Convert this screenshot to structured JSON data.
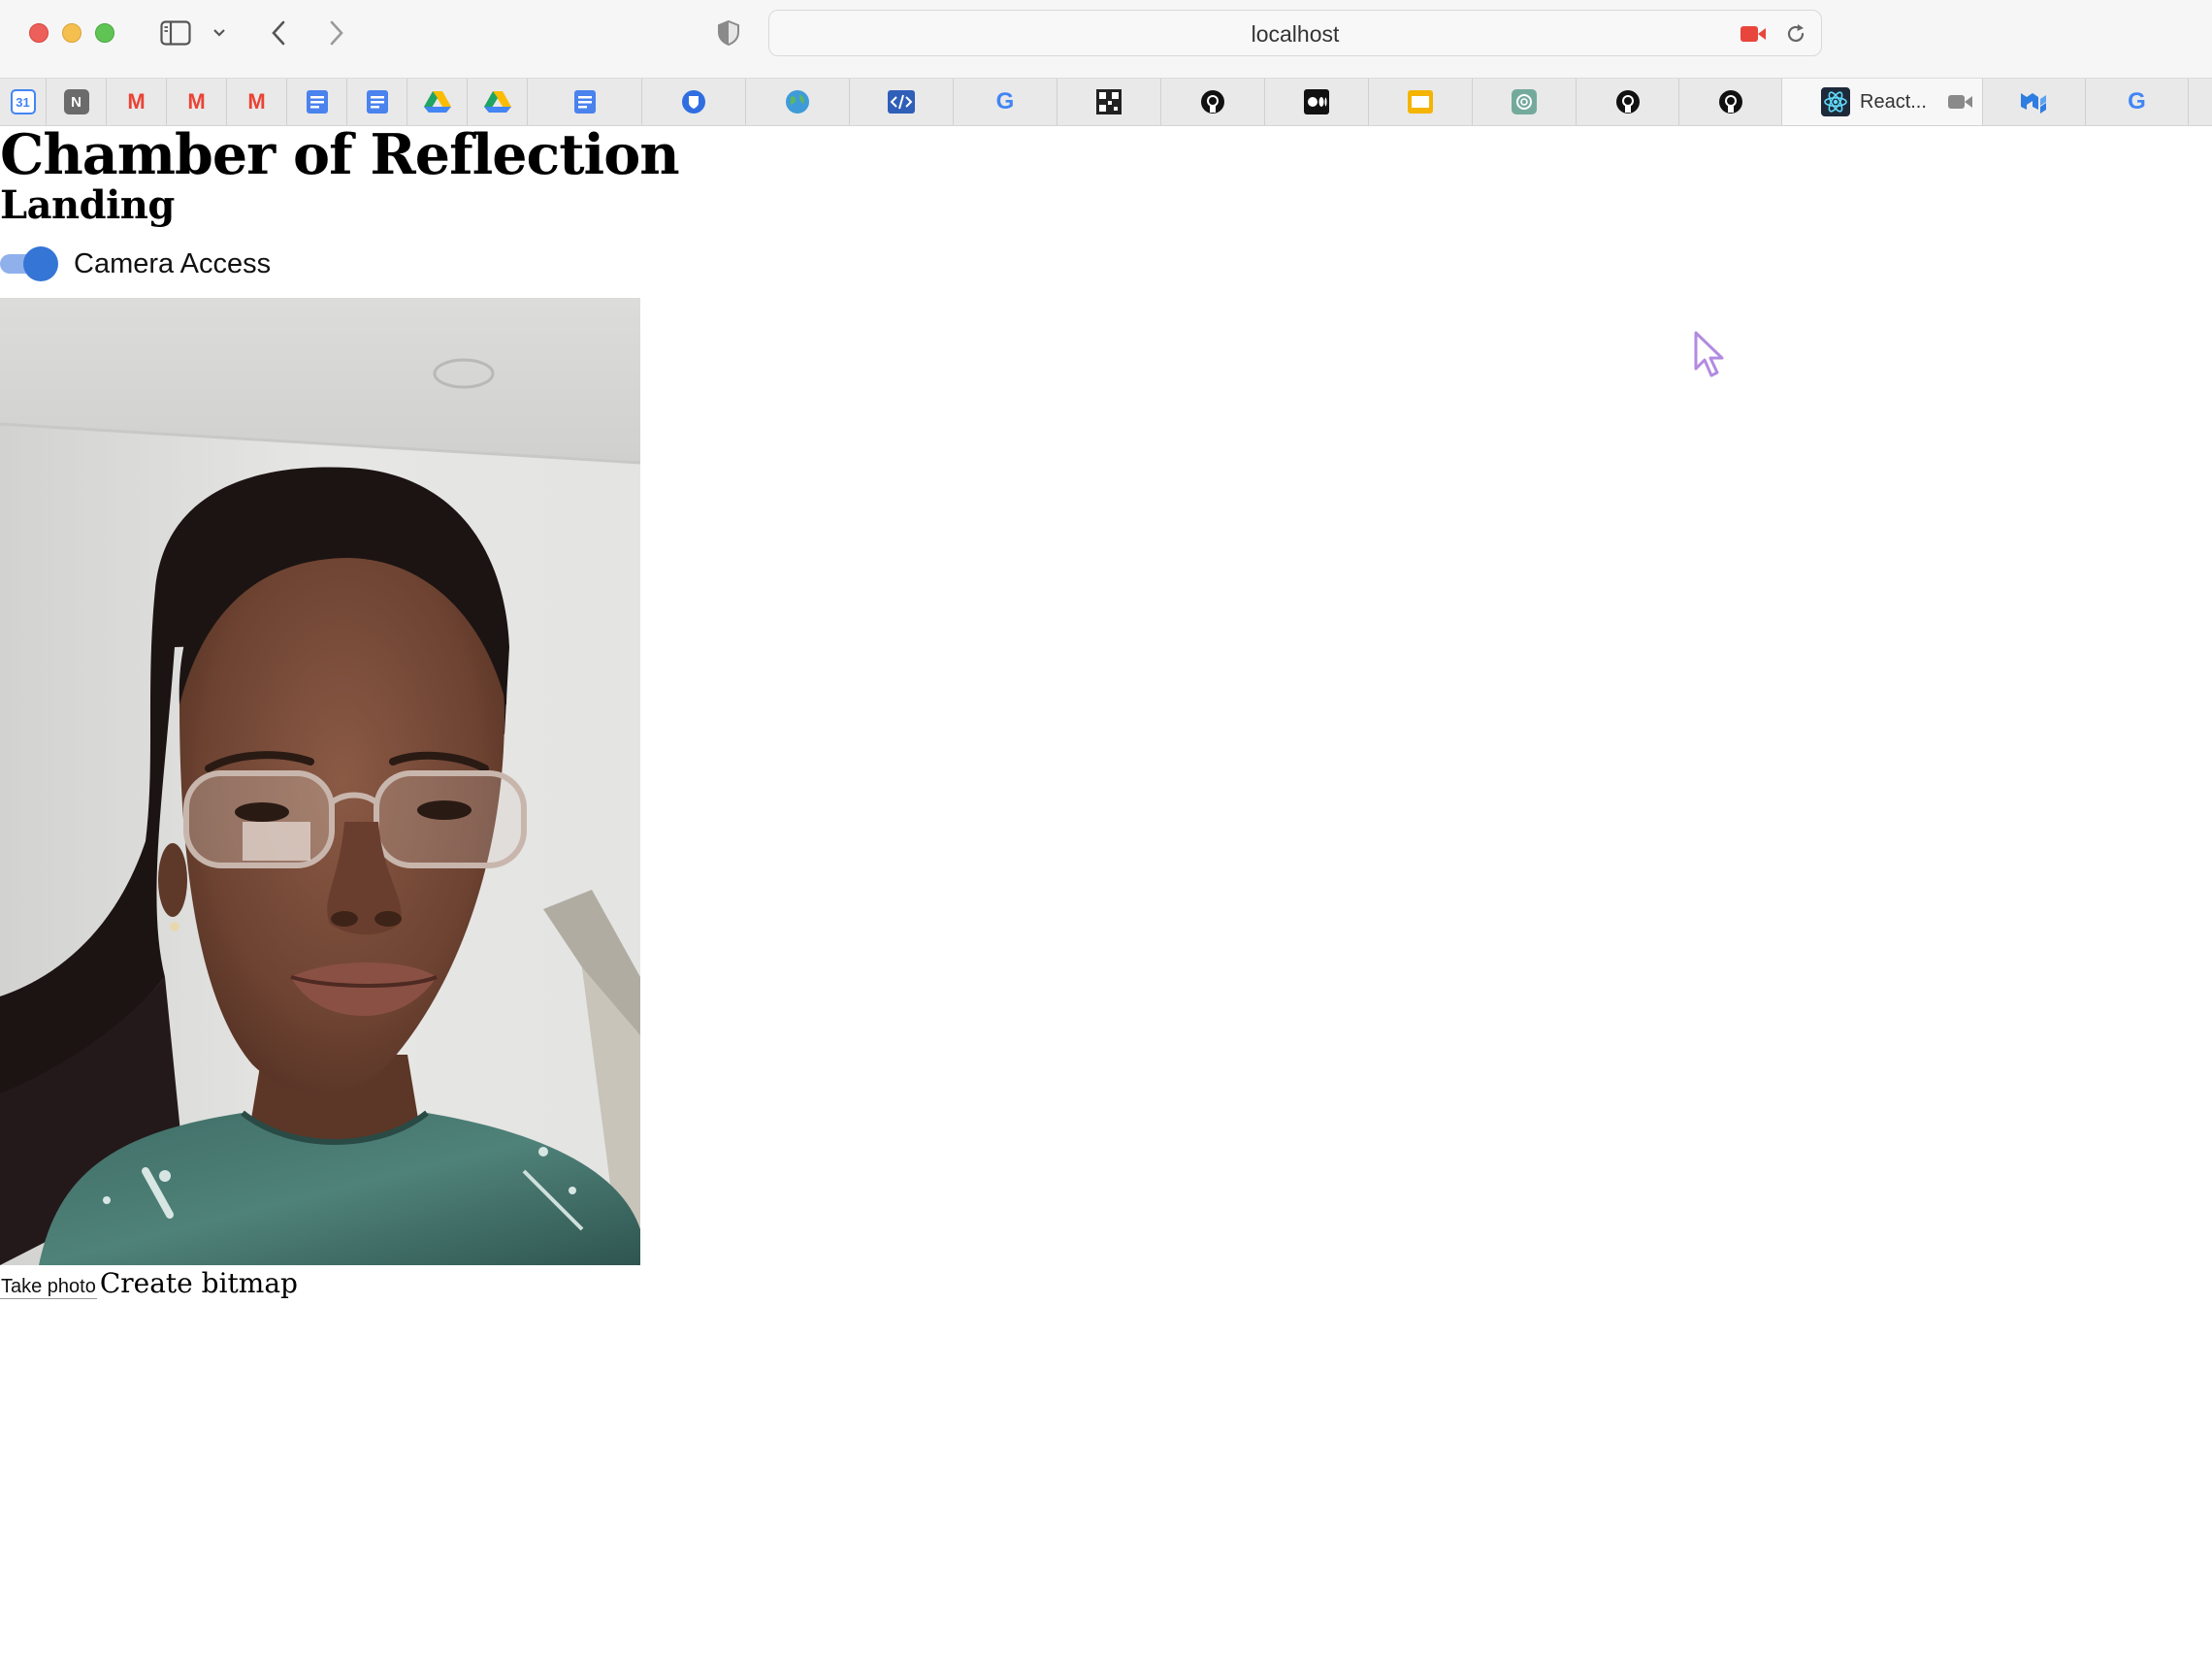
{
  "browser": {
    "url": "localhost",
    "tabs": [
      {
        "icon": "calendar-icon",
        "label": "31",
        "color": "#4285f4"
      },
      {
        "icon": "notion-icon",
        "label": "N",
        "color": "#6b6b6b"
      },
      {
        "icon": "gmail-icon",
        "label": "M",
        "color": "#ea4335"
      },
      {
        "icon": "gmail-icon",
        "label": "M",
        "color": "#ea4335"
      },
      {
        "icon": "gmail-icon",
        "label": "M",
        "color": "#ea4335"
      },
      {
        "icon": "docs-icon",
        "label": "",
        "color": "#4a82ee"
      },
      {
        "icon": "docs-icon",
        "label": "",
        "color": "#4a82ee"
      },
      {
        "icon": "drive-icon",
        "label": "",
        "color": "#1fa463"
      },
      {
        "icon": "drive-icon",
        "label": "",
        "color": "#1fa463"
      },
      {
        "icon": "docs-icon",
        "label": "",
        "color": "#4a82ee"
      },
      {
        "icon": "bitwarden-icon",
        "label": "",
        "color": "#2f6de1"
      },
      {
        "icon": "globe-icon",
        "label": "",
        "color": "#3f9bd8"
      },
      {
        "icon": "code-icon",
        "label": "",
        "color": "#2f5fb8"
      },
      {
        "icon": "google-icon",
        "label": "G",
        "color": "#4285f4"
      },
      {
        "icon": "qr-icon",
        "label": "",
        "color": "#222222"
      },
      {
        "icon": "github-icon",
        "label": "",
        "color": "#111111"
      },
      {
        "icon": "medium-icon",
        "label": "",
        "color": "#111111"
      },
      {
        "icon": "slides-icon",
        "label": "",
        "color": "#f4b400"
      },
      {
        "icon": "chatgpt-icon",
        "label": "",
        "color": "#74aa9c"
      },
      {
        "icon": "github-icon",
        "label": "",
        "color": "#111111"
      },
      {
        "icon": "github-icon",
        "label": "",
        "color": "#111111"
      },
      {
        "icon": "react-icon",
        "label": "React...",
        "color": "#61dafb",
        "active": true
      },
      {
        "icon": "mui-icon",
        "label": "",
        "color": "#2f7de1"
      },
      {
        "icon": "google-icon",
        "label": "G",
        "color": "#4285f4"
      }
    ]
  },
  "page": {
    "title": "Chamber of Reflection",
    "subtitle": "Landing",
    "camera_toggle": {
      "label": "Camera Access",
      "checked": true
    },
    "take_photo_label": "Take photo",
    "create_bitmap_label": "Create bitmap"
  }
}
